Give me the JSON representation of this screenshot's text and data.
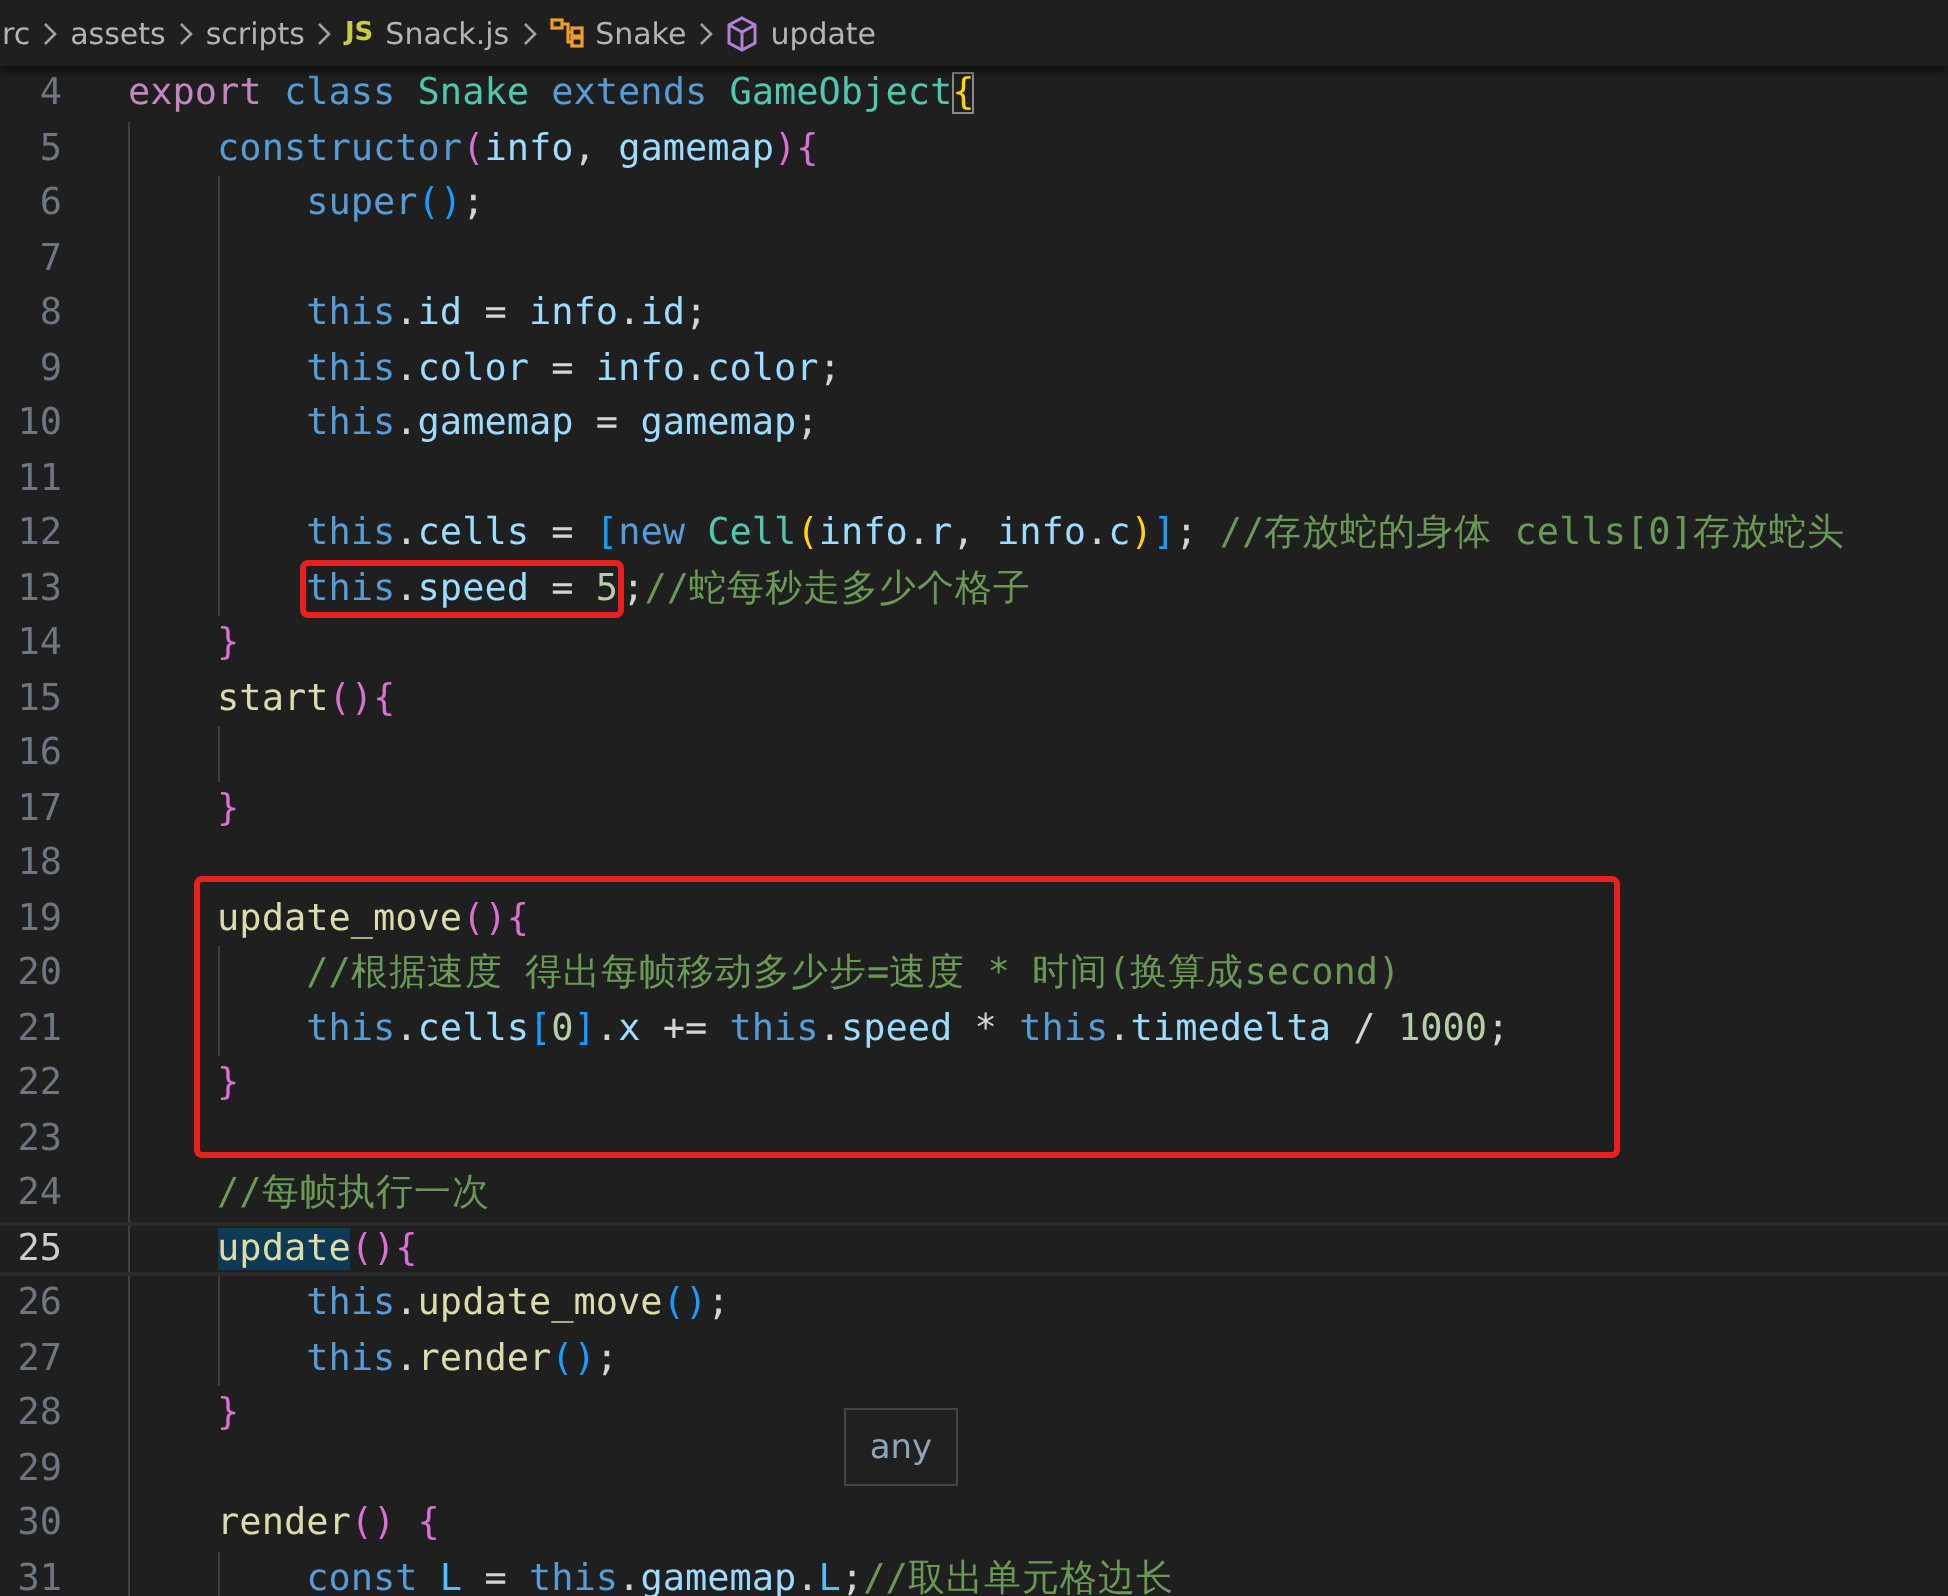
{
  "breadcrumb": [
    {
      "kind": "folder",
      "label": "rc"
    },
    {
      "kind": "folder",
      "label": "assets"
    },
    {
      "kind": "folder",
      "label": "scripts"
    },
    {
      "kind": "file",
      "label": "Snack.js",
      "icon_text": "JS"
    },
    {
      "kind": "class",
      "label": "Snake"
    },
    {
      "kind": "method",
      "label": "update"
    }
  ],
  "lines": [
    {
      "number": "4",
      "tokens": [
        {
          "kind": "kw",
          "text": "export "
        },
        {
          "kind": "st",
          "text": "class "
        },
        {
          "kind": "cls",
          "text": "Snake "
        },
        {
          "kind": "st",
          "text": "extends "
        },
        {
          "kind": "cls",
          "text": "GameObject"
        },
        {
          "kind": "b1",
          "text": "{",
          "matched": true
        }
      ],
      "children": [
        {
          "number": "5",
          "tokens": [
            {
              "kind": "st",
              "text": "constructor"
            },
            {
              "kind": "b2",
              "text": "("
            },
            {
              "kind": "var",
              "text": "info"
            },
            {
              "kind": "p",
              "text": ", "
            },
            {
              "kind": "var",
              "text": "gamemap"
            },
            {
              "kind": "b2",
              "text": "){"
            }
          ],
          "children": [
            {
              "number": "6",
              "tokens": [
                {
                  "kind": "st",
                  "text": "super"
                },
                {
                  "kind": "b3",
                  "text": "()"
                },
                {
                  "kind": "p",
                  "text": ";"
                }
              ]
            },
            {
              "number": "7"
            },
            {
              "number": "8",
              "tokens": [
                {
                  "kind": "st",
                  "text": "this"
                },
                {
                  "kind": "p",
                  "text": "."
                },
                {
                  "kind": "var",
                  "text": "id"
                },
                {
                  "kind": "p",
                  "text": " = "
                },
                {
                  "kind": "var",
                  "text": "info"
                },
                {
                  "kind": "p",
                  "text": "."
                },
                {
                  "kind": "var",
                  "text": "id"
                },
                {
                  "kind": "p",
                  "text": ";"
                }
              ]
            },
            {
              "number": "9",
              "tokens": [
                {
                  "kind": "st",
                  "text": "this"
                },
                {
                  "kind": "p",
                  "text": "."
                },
                {
                  "kind": "var",
                  "text": "color"
                },
                {
                  "kind": "p",
                  "text": " = "
                },
                {
                  "kind": "var",
                  "text": "info"
                },
                {
                  "kind": "p",
                  "text": "."
                },
                {
                  "kind": "var",
                  "text": "color"
                },
                {
                  "kind": "p",
                  "text": ";"
                }
              ]
            },
            {
              "number": "10",
              "tokens": [
                {
                  "kind": "st",
                  "text": "this"
                },
                {
                  "kind": "p",
                  "text": "."
                },
                {
                  "kind": "var",
                  "text": "gamemap"
                },
                {
                  "kind": "p",
                  "text": " = "
                },
                {
                  "kind": "var",
                  "text": "gamemap"
                },
                {
                  "kind": "p",
                  "text": ";"
                }
              ]
            },
            {
              "number": "11"
            },
            {
              "number": "12",
              "tokens": [
                {
                  "kind": "st",
                  "text": "this"
                },
                {
                  "kind": "p",
                  "text": "."
                },
                {
                  "kind": "var",
                  "text": "cells"
                },
                {
                  "kind": "p",
                  "text": " = "
                },
                {
                  "kind": "b3",
                  "text": "["
                },
                {
                  "kind": "st",
                  "text": "new "
                },
                {
                  "kind": "cls",
                  "text": "Cell"
                },
                {
                  "kind": "b1",
                  "text": "("
                },
                {
                  "kind": "var",
                  "text": "info"
                },
                {
                  "kind": "p",
                  "text": "."
                },
                {
                  "kind": "var",
                  "text": "r"
                },
                {
                  "kind": "p",
                  "text": ", "
                },
                {
                  "kind": "var",
                  "text": "info"
                },
                {
                  "kind": "p",
                  "text": "."
                },
                {
                  "kind": "var",
                  "text": "c"
                },
                {
                  "kind": "b1",
                  "text": ")"
                },
                {
                  "kind": "b3",
                  "text": "]"
                },
                {
                  "kind": "p",
                  "text": "; "
                },
                {
                  "kind": "com",
                  "text": "//存放蛇的身体 cells[0]存放蛇头"
                }
              ]
            },
            {
              "number": "13",
              "annotated_tokens": [
                {
                  "kind": "st",
                  "text": "this"
                },
                {
                  "kind": "p",
                  "text": "."
                },
                {
                  "kind": "var",
                  "text": "speed"
                },
                {
                  "kind": "p",
                  "text": " = "
                },
                {
                  "kind": "num",
                  "text": "5"
                }
              ],
              "tokens": [
                {
                  "kind": "p",
                  "text": ";"
                },
                {
                  "kind": "com",
                  "text": "//蛇每秒走多少个格子"
                }
              ]
            }
          ]
        },
        {
          "number": "14",
          "tokens": [
            {
              "kind": "b2",
              "text": "}"
            }
          ]
        },
        {
          "number": "15",
          "tokens": [
            {
              "kind": "fn",
              "text": "start"
            },
            {
              "kind": "b2",
              "text": "(){"
            }
          ],
          "children": [
            {
              "number": "16"
            }
          ]
        },
        {
          "number": "17",
          "tokens": [
            {
              "kind": "b2",
              "text": "}"
            }
          ]
        },
        {
          "number": "18"
        },
        {
          "number": "19",
          "boxed": true,
          "tokens": [
            {
              "kind": "fn",
              "text": "update_move"
            },
            {
              "kind": "b2",
              "text": "(){"
            }
          ],
          "children": [
            {
              "number": "20",
              "boxed": true,
              "tokens": [
                {
                  "kind": "com",
                  "text": "//根据速度 得出每帧移动多少步=速度 * 时间(换算成second)"
                }
              ]
            },
            {
              "number": "21",
              "boxed": true,
              "tokens": [
                {
                  "kind": "st",
                  "text": "this"
                },
                {
                  "kind": "p",
                  "text": "."
                },
                {
                  "kind": "var",
                  "text": "cells"
                },
                {
                  "kind": "b3",
                  "text": "["
                },
                {
                  "kind": "num",
                  "text": "0"
                },
                {
                  "kind": "b3",
                  "text": "]"
                },
                {
                  "kind": "p",
                  "text": "."
                },
                {
                  "kind": "var",
                  "text": "x"
                },
                {
                  "kind": "p",
                  "text": " += "
                },
                {
                  "kind": "st",
                  "text": "this"
                },
                {
                  "kind": "p",
                  "text": "."
                },
                {
                  "kind": "var",
                  "text": "speed"
                },
                {
                  "kind": "p",
                  "text": " * "
                },
                {
                  "kind": "st",
                  "text": "this"
                },
                {
                  "kind": "p",
                  "text": "."
                },
                {
                  "kind": "var",
                  "text": "timedelta"
                },
                {
                  "kind": "p",
                  "text": " / "
                },
                {
                  "kind": "num",
                  "text": "1000"
                },
                {
                  "kind": "p",
                  "text": ";"
                }
              ]
            }
          ]
        },
        {
          "number": "22",
          "boxed": true,
          "tokens": [
            {
              "kind": "b2",
              "text": "}"
            }
          ]
        },
        {
          "number": "23"
        },
        {
          "number": "24",
          "tokens": [
            {
              "kind": "com",
              "text": "//每帧执行一次"
            }
          ]
        },
        {
          "number": "25",
          "current": true,
          "tokens": [
            {
              "kind": "fn",
              "text": "update",
              "highlighted": true
            },
            {
              "kind": "b2",
              "text": "(){"
            }
          ],
          "children": [
            {
              "number": "26",
              "tokens": [
                {
                  "kind": "st",
                  "text": "this"
                },
                {
                  "kind": "p",
                  "text": "."
                },
                {
                  "kind": "fn",
                  "text": "update_move"
                },
                {
                  "kind": "b3",
                  "text": "()"
                },
                {
                  "kind": "p",
                  "text": ";"
                }
              ]
            },
            {
              "number": "27",
              "tokens": [
                {
                  "kind": "st",
                  "text": "this"
                },
                {
                  "kind": "p",
                  "text": "."
                },
                {
                  "kind": "fn",
                  "text": "render"
                },
                {
                  "kind": "b3",
                  "text": "()"
                },
                {
                  "kind": "p",
                  "text": ";"
                }
              ]
            }
          ]
        },
        {
          "number": "28",
          "tokens": [
            {
              "kind": "b2",
              "text": "}"
            }
          ]
        },
        {
          "number": "29"
        },
        {
          "number": "30",
          "tokens": [
            {
              "kind": "fn",
              "text": "render"
            },
            {
              "kind": "b2",
              "text": "() {"
            }
          ],
          "children": [
            {
              "number": "31",
              "tokens": [
                {
                  "kind": "st",
                  "text": "const "
                },
                {
                  "kind": "cst",
                  "text": "L"
                },
                {
                  "kind": "p",
                  "text": " = "
                },
                {
                  "kind": "st",
                  "text": "this"
                },
                {
                  "kind": "p",
                  "text": "."
                },
                {
                  "kind": "var",
                  "text": "gamemap"
                },
                {
                  "kind": "p",
                  "text": "."
                },
                {
                  "kind": "cst",
                  "text": "L"
                },
                {
                  "kind": "p",
                  "text": ";"
                },
                {
                  "kind": "com",
                  "text": "//取出单元格边长"
                }
              ]
            }
          ]
        }
      ]
    }
  ],
  "hover_tooltip": {
    "text": "any"
  }
}
